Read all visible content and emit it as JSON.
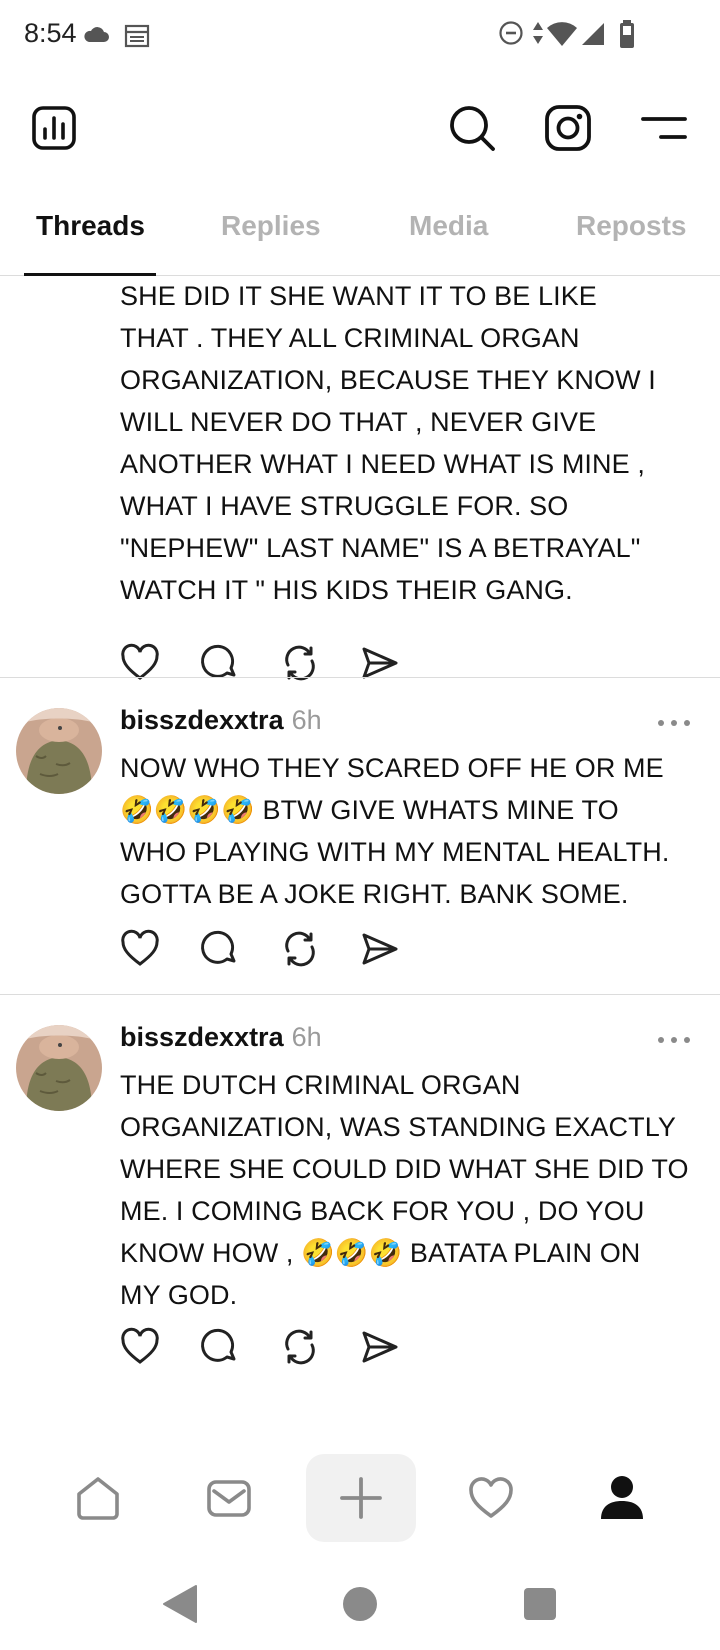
{
  "status_bar": {
    "time": "8:54",
    "left_icons": [
      "cloud-icon",
      "calendar-icon"
    ],
    "right_icons": [
      "do-not-disturb-icon",
      "data-arrows-icon",
      "wifi-icon",
      "cellular-signal-icon",
      "battery-icon"
    ]
  },
  "header": {
    "icons": [
      "insights-icon",
      "search-icon",
      "instagram-icon",
      "menu-icon"
    ]
  },
  "tabs": [
    {
      "label": "Threads",
      "active": true
    },
    {
      "label": "Replies",
      "active": false
    },
    {
      "label": "Media",
      "active": false
    },
    {
      "label": "Reposts",
      "active": false
    }
  ],
  "posts": [
    {
      "lines": [
        "SHE DID IT SHE WANT IT TO BE LIKE",
        "THAT . THEY ALL CRIMINAL ORGAN",
        "ORGANIZATION, BECAUSE THEY KNOW I",
        "WILL NEVER DO THAT , NEVER GIVE",
        "ANOTHER WHAT I NEED WHAT IS MINE ,",
        "WHAT I HAVE STRUGGLE FOR. SO",
        "\"NEPHEW\" LAST NAME\" IS A BETRAYAL\"",
        "WATCH IT \" HIS KIDS THEIR GANG."
      ]
    },
    {
      "username": "bisszdexxtra",
      "timestamp": "6h",
      "lines": [
        "NOW WHO THEY SCARED OFF HE OR ME",
        "🤣🤣🤣🤣 BTW GIVE WHATS MINE TO",
        "WHO PLAYING WITH MY MENTAL HEALTH.",
        "GOTTA BE A JOKE RIGHT. BANK SOME."
      ]
    },
    {
      "username": "bisszdexxtra",
      "timestamp": "6h",
      "lines": [
        "THE DUTCH CRIMINAL ORGAN",
        "ORGANIZATION, WAS STANDING EXACTLY",
        "WHERE SHE COULD DID WHAT SHE DID TO",
        "ME. I COMING BACK FOR YOU , DO YOU",
        "KNOW HOW , 🤣🤣🤣 BATATA PLAIN ON",
        "MY GOD."
      ]
    }
  ],
  "actions": [
    "like-icon",
    "reply-icon",
    "repost-icon",
    "share-icon"
  ],
  "bottom_nav": [
    "home-icon",
    "inbox-icon",
    "create-icon",
    "activity-icon",
    "profile-icon"
  ],
  "colors": {
    "text": "#111111",
    "muted": "#9a9a9a",
    "tab_inactive": "#b3b3b3",
    "divider": "#dcdcdc",
    "icon": "#222222",
    "nav_inactive": "#8a8a8a"
  }
}
